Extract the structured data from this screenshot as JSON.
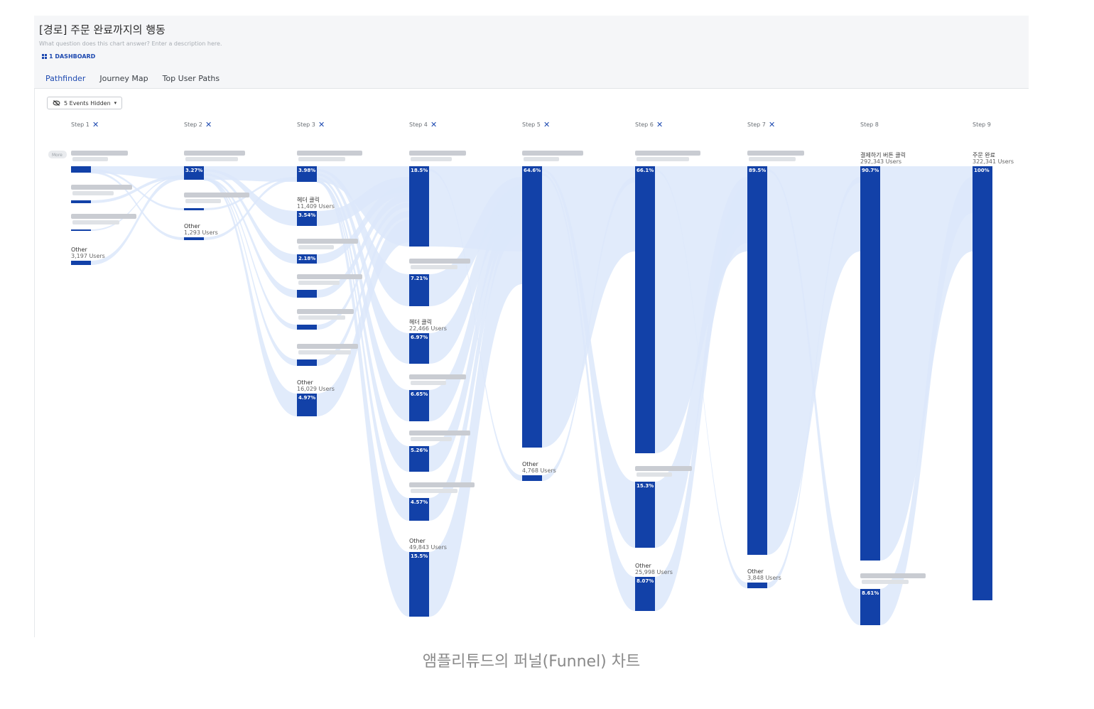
{
  "header": {
    "title": "[경로] 주문 완료까지의 행동",
    "description_placeholder": "What question does this chart answer? Enter a description here.",
    "dashboard_link": "1 DASHBOARD"
  },
  "tabs": [
    {
      "label": "Pathfinder",
      "active": true
    },
    {
      "label": "Journey Map",
      "active": false
    },
    {
      "label": "Top User Paths",
      "active": false
    }
  ],
  "toolbar": {
    "events_hidden": "5 Events Hidden"
  },
  "more_label": "More",
  "steps": [
    {
      "label": "Step 1",
      "removable": true
    },
    {
      "label": "Step 2",
      "removable": true
    },
    {
      "label": "Step 3",
      "removable": true
    },
    {
      "label": "Step 4",
      "removable": true
    },
    {
      "label": "Step 5",
      "removable": true
    },
    {
      "label": "Step 6",
      "removable": true
    },
    {
      "label": "Step 7",
      "removable": true
    },
    {
      "label": "Step 8",
      "removable": false
    },
    {
      "label": "Step 9",
      "removable": false
    }
  ],
  "nodes": {
    "step1": [
      {
        "name": "",
        "users": "",
        "pct": "",
        "blurred": true
      },
      {
        "name": "",
        "users": "",
        "pct": "",
        "blurred": true
      },
      {
        "name": "",
        "users": "",
        "pct": "",
        "blurred": true
      },
      {
        "name": "Other",
        "users": "3,197 Users",
        "pct": ""
      }
    ],
    "step2": [
      {
        "name": "",
        "users": "",
        "pct": "3.27%",
        "blurred": true
      },
      {
        "name": "",
        "users": "",
        "pct": "",
        "blurred": true
      },
      {
        "name": "Other",
        "users": "1,293 Users",
        "pct": ""
      }
    ],
    "step3": [
      {
        "name": "",
        "users": "",
        "pct": "3.98%",
        "blurred": true
      },
      {
        "name": "헤더 클릭",
        "users": "11,409 Users",
        "pct": "3.54%"
      },
      {
        "name": "",
        "users": "",
        "pct": "2.18%",
        "blurred": true
      },
      {
        "name": "",
        "users": "",
        "pct": "",
        "blurred": true
      },
      {
        "name": "",
        "users": "",
        "pct": "",
        "blurred": true
      },
      {
        "name": "",
        "users": "",
        "pct": "",
        "blurred": true
      },
      {
        "name": "Other",
        "users": "16,029 Users",
        "pct": "4.97%"
      }
    ],
    "step4": [
      {
        "name": "",
        "users": "",
        "pct": "18.5%",
        "blurred": true
      },
      {
        "name": "",
        "users": "",
        "pct": "7.21%",
        "blurred": true
      },
      {
        "name": "헤더 클릭",
        "users": "22,466 Users",
        "pct": "6.97%"
      },
      {
        "name": "",
        "users": "",
        "pct": "6.65%",
        "blurred": true
      },
      {
        "name": "",
        "users": "",
        "pct": "5.26%",
        "blurred": true
      },
      {
        "name": "",
        "users": "",
        "pct": "4.57%",
        "blurred": true
      },
      {
        "name": "Other",
        "users": "49,843 Users",
        "pct": "15.5%"
      }
    ],
    "step5": [
      {
        "name": "",
        "users": "",
        "pct": "64.6%",
        "blurred": true
      },
      {
        "name": "Other",
        "users": "4,768 Users",
        "pct": ""
      }
    ],
    "step6": [
      {
        "name": "",
        "users": "",
        "pct": "66.1%",
        "blurred": true
      },
      {
        "name": "",
        "users": "",
        "pct": "15.3%",
        "blurred": true
      },
      {
        "name": "Other",
        "users": "25,998 Users",
        "pct": "8.07%"
      }
    ],
    "step7": [
      {
        "name": "",
        "users": "",
        "pct": "89.5%",
        "blurred": true
      },
      {
        "name": "Other",
        "users": "3,848 Users",
        "pct": ""
      }
    ],
    "step8": [
      {
        "name": "결제하기 버튼 클릭",
        "users": "292,343 Users",
        "pct": "90.7%"
      },
      {
        "name": "",
        "users": "",
        "pct": "8.61%",
        "blurred": true
      }
    ],
    "step9": [
      {
        "name": "주문 완료",
        "users": "322,341 Users",
        "pct": "100%"
      }
    ]
  },
  "colors": {
    "bar": "#1241a8",
    "flow": "#dce8fa",
    "accent": "#1d49b0"
  },
  "icons": {
    "remove": "close-icon",
    "visibility": "eye-off-icon",
    "dropdown": "chevron-down-icon",
    "dashboard": "grid-icon"
  },
  "caption": "앰플리튜드의 퍼널(Funnel) 차트"
}
